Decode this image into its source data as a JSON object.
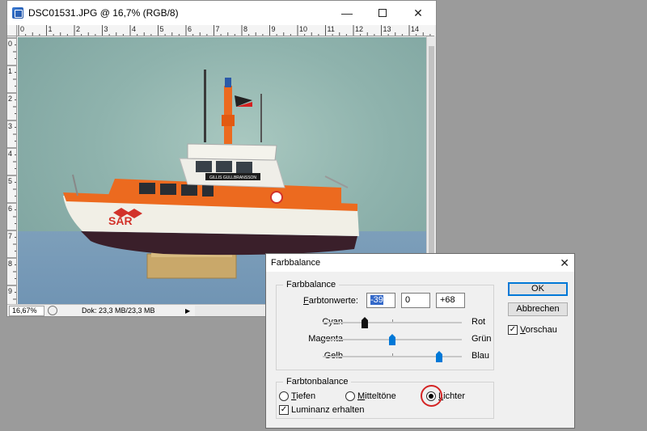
{
  "document": {
    "title": "DSC01531.JPG @ 16,7% (RGB/8)",
    "ruler_top": [
      "0",
      "1",
      "2",
      "3",
      "4",
      "5",
      "6",
      "7",
      "8",
      "9",
      "10",
      "11",
      "12",
      "13",
      "14"
    ],
    "ruler_left": [
      "0",
      "1",
      "2",
      "3",
      "4",
      "5",
      "6",
      "7",
      "8",
      "9"
    ],
    "zoom": "16,67%",
    "doc_size": "Dok: 23,3 MB/23,3 MB",
    "image_text_sar": "SAR",
    "image_text_name": "GILLIS GULLBRANSSON"
  },
  "dialog": {
    "title": "Farbbalance",
    "group_color_balance": "Farbbalance",
    "tone_values_label": "Farbtonwerte:",
    "values": [
      "-39",
      "0",
      "+68"
    ],
    "sliders": [
      {
        "left": "Cyan",
        "right": "Rot",
        "value": -39
      },
      {
        "left": "Magenta",
        "right": "Grün",
        "value": 0
      },
      {
        "left": "Gelb",
        "right": "Blau",
        "value": 68
      }
    ],
    "group_tone_balance": "Farbtonbalance",
    "radios": [
      {
        "label": "Tiefen",
        "selected": false
      },
      {
        "label": "Mitteltöne",
        "selected": false
      },
      {
        "label": "Lichter",
        "selected": true
      }
    ],
    "preserve_luminosity": "Luminanz erhalten",
    "ok": "OK",
    "cancel": "Abbrechen",
    "preview": "Vorschau"
  },
  "colors": {
    "accent": "#0078d7",
    "highlight_ring": "#d42424",
    "hull_orange": "#ec6a1f"
  }
}
